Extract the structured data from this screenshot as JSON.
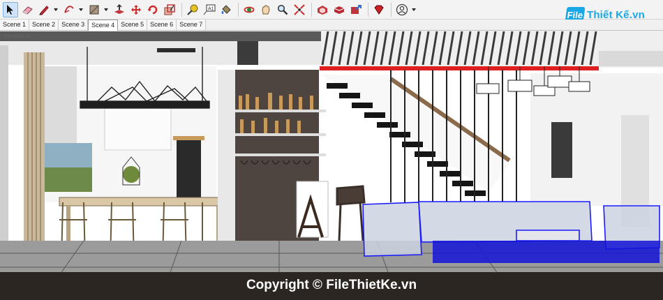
{
  "toolbar": {
    "tools": [
      {
        "name": "select-tool-icon",
        "selected": true
      },
      {
        "name": "eraser-tool-icon"
      },
      {
        "name": "pencil-line-tool-icon",
        "dropdown": true
      },
      {
        "name": "arc-tool-icon",
        "dropdown": true
      },
      {
        "name": "rectangle-shape-tool-icon",
        "dropdown": true
      },
      {
        "name": "push-pull-tool-icon"
      },
      {
        "name": "move-tool-icon"
      },
      {
        "name": "rotate-tool-icon"
      },
      {
        "name": "scale-tool-icon"
      },
      {
        "name": "tape-measure-tool-icon"
      },
      {
        "name": "text-tool-icon"
      },
      {
        "name": "paint-bucket-tool-icon"
      },
      {
        "name": "orbit-tool-icon"
      },
      {
        "name": "pan-tool-icon"
      },
      {
        "name": "zoom-tool-icon"
      },
      {
        "name": "zoom-extents-tool-icon"
      },
      {
        "name": "3d-warehouse-icon"
      },
      {
        "name": "extension-warehouse-icon"
      },
      {
        "name": "share-model-icon"
      },
      {
        "name": "ruby-console-icon"
      },
      {
        "name": "account-icon",
        "dropdown": true
      }
    ]
  },
  "scenes": [
    "Scene 1",
    "Scene 2",
    "Scene 3",
    "Scene 4",
    "Scene 5",
    "Scene 6",
    "Scene 7"
  ],
  "active_scene": "Scene 4",
  "logo": {
    "mark": "File",
    "brand": "Thiết Kế.vn"
  },
  "viewport": {
    "camera_label": "Perspective",
    "watermark": "Copyright © FileThietKe.vn"
  },
  "colors": {
    "selection": "#1a1aff",
    "accent_red": "#e02020",
    "logo_blue": "#1aa7e6"
  }
}
